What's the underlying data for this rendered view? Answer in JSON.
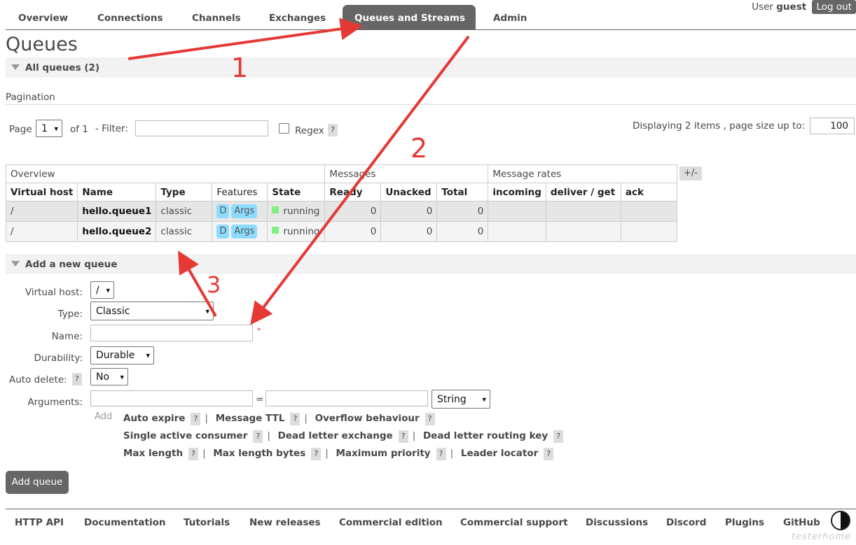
{
  "nav": {
    "tabs": [
      "Overview",
      "Connections",
      "Channels",
      "Exchanges",
      "Queues and Streams",
      "Admin"
    ],
    "active": "Queues and Streams",
    "user_label": "User",
    "user_name": "guest",
    "logout_label": "Log out"
  },
  "page_title": "Queues",
  "all_queues": {
    "label": "All queues (2)"
  },
  "pagination": {
    "heading": "Pagination",
    "page_label": "Page",
    "page_value": "1",
    "of_label": "of 1",
    "filter_label": "- Filter:",
    "filter_value": "",
    "regex_label": "Regex",
    "help": "?",
    "display_text": "Displaying 2 items , page size up to:",
    "page_size": "100"
  },
  "table": {
    "group_headers": [
      "Overview",
      "Messages",
      "Message rates"
    ],
    "plusminus": "+/-",
    "columns": [
      "Virtual host",
      "Name",
      "Type",
      "Features",
      "State",
      "Ready",
      "Unacked",
      "Total",
      "incoming",
      "deliver / get",
      "ack"
    ],
    "rows": [
      {
        "vhost": "/",
        "name": "hello.queue1",
        "type": "classic",
        "feature_d": "D",
        "feature_args": "Args",
        "state": "running",
        "ready": "0",
        "unacked": "0",
        "total": "0"
      },
      {
        "vhost": "/",
        "name": "hello.queue2",
        "type": "classic",
        "feature_d": "D",
        "feature_args": "Args",
        "state": "running",
        "ready": "0",
        "unacked": "0",
        "total": "0"
      }
    ]
  },
  "add_queue": {
    "section_label": "Add a new queue",
    "vhost_label": "Virtual host:",
    "vhost_value": "/",
    "type_label": "Type:",
    "type_value": "Classic",
    "name_label": "Name:",
    "name_value": "",
    "required_mark": "*",
    "durability_label": "Durability:",
    "durability_value": "Durable",
    "autodelete_label": "Auto delete:",
    "autodelete_value": "No",
    "arguments_label": "Arguments:",
    "arg_eq": "=",
    "arg_type_value": "String",
    "add_label": "Add",
    "arg_options_row1": [
      "Auto expire",
      "Message TTL",
      "Overflow behaviour"
    ],
    "arg_options_row2": [
      "Single active consumer",
      "Dead letter exchange",
      "Dead letter routing key"
    ],
    "arg_options_row3": [
      "Max length",
      "Max length bytes",
      "Maximum priority",
      "Leader locator"
    ],
    "submit_label": "Add queue"
  },
  "footer": {
    "links": [
      "HTTP API",
      "Documentation",
      "Tutorials",
      "New releases",
      "Commercial edition",
      "Commercial support",
      "Discussions",
      "Discord",
      "Plugins",
      "GitHub"
    ]
  },
  "watermark": "testerhome",
  "annotations": {
    "n1": "1",
    "n2": "2",
    "n3": "3",
    "color": "#e53935"
  }
}
